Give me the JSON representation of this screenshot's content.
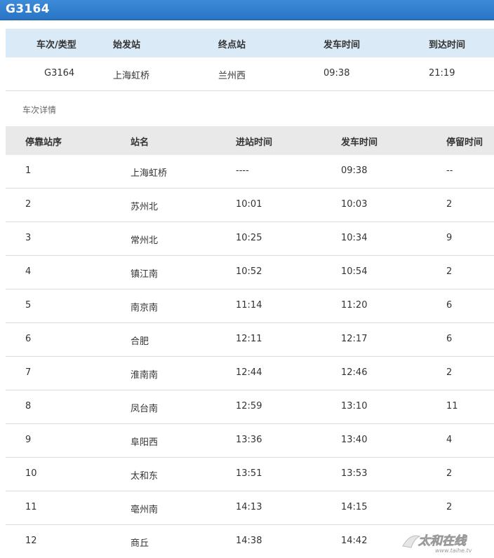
{
  "header": {
    "title": "G3164"
  },
  "summary": {
    "columns": [
      "车次/类型",
      "始发站",
      "终点站",
      "发车时间",
      "到达时间"
    ],
    "values": [
      "G3164",
      "上海虹桥",
      "兰州西",
      "09:38",
      "21:19"
    ]
  },
  "section": {
    "label": "车次详情"
  },
  "details": {
    "columns": [
      "停靠站序",
      "站名",
      "进站时间",
      "发车时间",
      "停留时间"
    ],
    "rows": [
      [
        "1",
        "上海虹桥",
        "----",
        "09:38",
        "--"
      ],
      [
        "2",
        "苏州北",
        "10:01",
        "10:03",
        "2"
      ],
      [
        "3",
        "常州北",
        "10:25",
        "10:34",
        "9"
      ],
      [
        "4",
        "镇江南",
        "10:52",
        "10:54",
        "2"
      ],
      [
        "5",
        "南京南",
        "11:14",
        "11:20",
        "6"
      ],
      [
        "6",
        "合肥",
        "12:11",
        "12:17",
        "6"
      ],
      [
        "7",
        "淮南南",
        "12:44",
        "12:46",
        "2"
      ],
      [
        "8",
        "凤台南",
        "12:59",
        "13:10",
        "11"
      ],
      [
        "9",
        "阜阳西",
        "13:36",
        "13:40",
        "4"
      ],
      [
        "10",
        "太和东",
        "13:51",
        "13:53",
        "2"
      ],
      [
        "11",
        "亳州南",
        "14:13",
        "14:15",
        "2"
      ],
      [
        "12",
        "商丘",
        "14:38",
        "14:42",
        ""
      ]
    ]
  },
  "watermark": {
    "logo_text": "太和在线",
    "logo_url": "www.taihe.tv"
  },
  "colors": {
    "topbar": "#2f7bd0",
    "summary_header": "#daeaf7",
    "details_header": "#e9e9e9"
  }
}
